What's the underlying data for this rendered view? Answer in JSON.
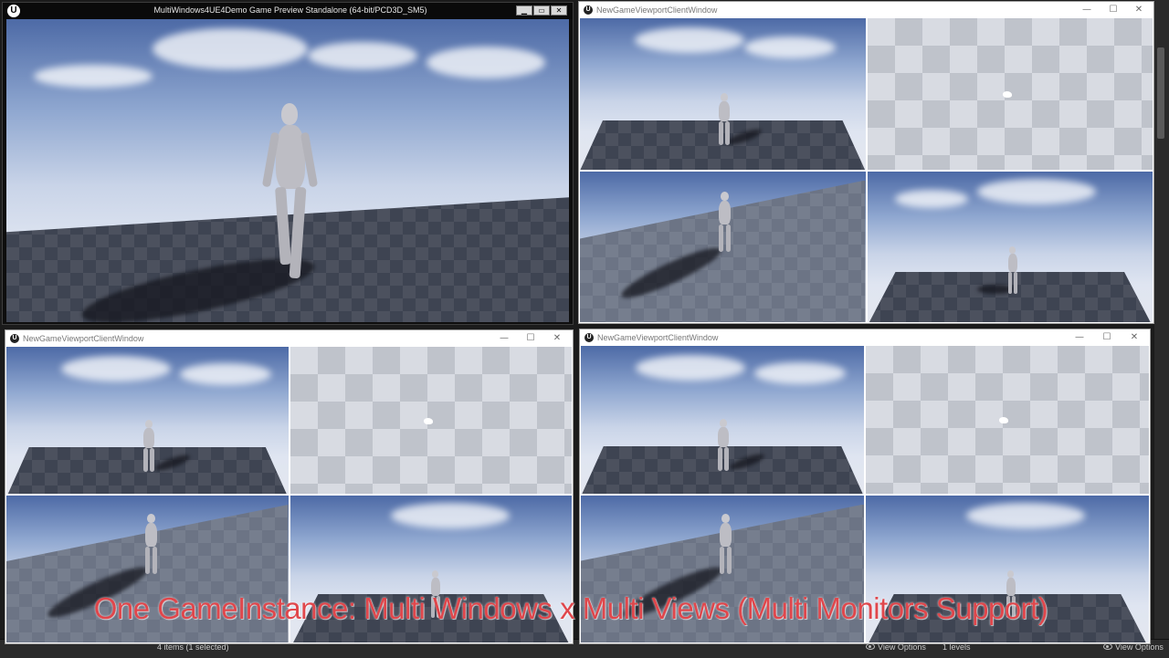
{
  "main_window": {
    "title": "MultiWindows4UE4Demo Game Preview Standalone (64-bit/PCD3D_SM5)",
    "logo": "ue-logo-icon",
    "controls": [
      "minimize-icon",
      "maximize-icon",
      "close-icon"
    ]
  },
  "client_windows": [
    {
      "title": "NewGameViewportClientWindow",
      "views": [
        "third-person",
        "empty-checker",
        "low-angle",
        "wide-field"
      ]
    },
    {
      "title": "NewGameViewportClientWindow",
      "views": [
        "third-person",
        "empty-checker",
        "low-angle",
        "wide-field"
      ]
    },
    {
      "title": "NewGameViewportClientWindow",
      "views": [
        "third-person",
        "empty-checker",
        "low-angle",
        "wide-field"
      ]
    }
  ],
  "window_buttons": {
    "minimize": "—",
    "maximize": "☐",
    "close": "✕"
  },
  "editor_status": {
    "items_selected": "4 items (1 selected)",
    "view_options": "View Options",
    "levels": "1 levels"
  },
  "caption": "One GameInstance: Multi Windows x Multi Views (Multi Monitors Support)",
  "colors": {
    "caption": "#e0474c",
    "sky_top": "#4d6aa6",
    "floor": "#3e4452"
  }
}
